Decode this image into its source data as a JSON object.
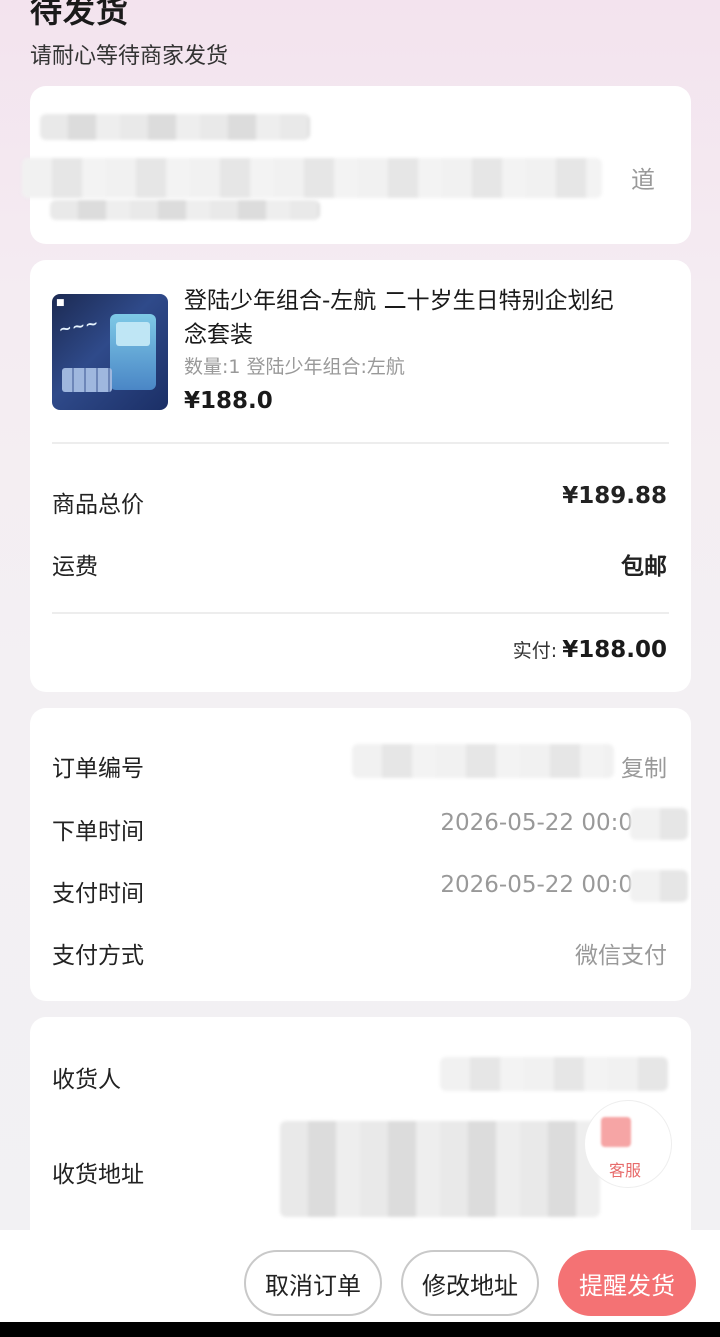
{
  "header": {
    "title": "待发货",
    "subtitle": "请耐心等待商家发货"
  },
  "address_card": {
    "visible_tail": "道"
  },
  "product": {
    "title": "登陆少年组合-左航 二十岁生日特别企划纪念套装",
    "meta": "数量:1 登陆少年组合:左航",
    "price": "¥188.0"
  },
  "summary": {
    "goods_total_label": "商品总价",
    "goods_total_value": "¥189.88",
    "shipping_label": "运费",
    "shipping_value": "包邮",
    "paid_label": "实付:",
    "paid_value": "¥188.00"
  },
  "order_info": {
    "order_no_label": "订单编号",
    "copy_label": "复制",
    "order_time_label": "下单时间",
    "order_time_value": "2026-05-22 00:0",
    "pay_time_label": "支付时间",
    "pay_time_value": "2026-05-22 00:0",
    "pay_method_label": "支付方式",
    "pay_method_value": "微信支付"
  },
  "receiver": {
    "name_label": "收货人",
    "address_label": "收货地址"
  },
  "customer_service": {
    "label": "客服",
    "icon": "headset-icon"
  },
  "actions": {
    "cancel_label": "取消订单",
    "modify_label": "修改地址",
    "remind_label": "提醒发货"
  },
  "colors": {
    "primary": "#f47274",
    "muted": "#999999",
    "text": "#222222"
  }
}
